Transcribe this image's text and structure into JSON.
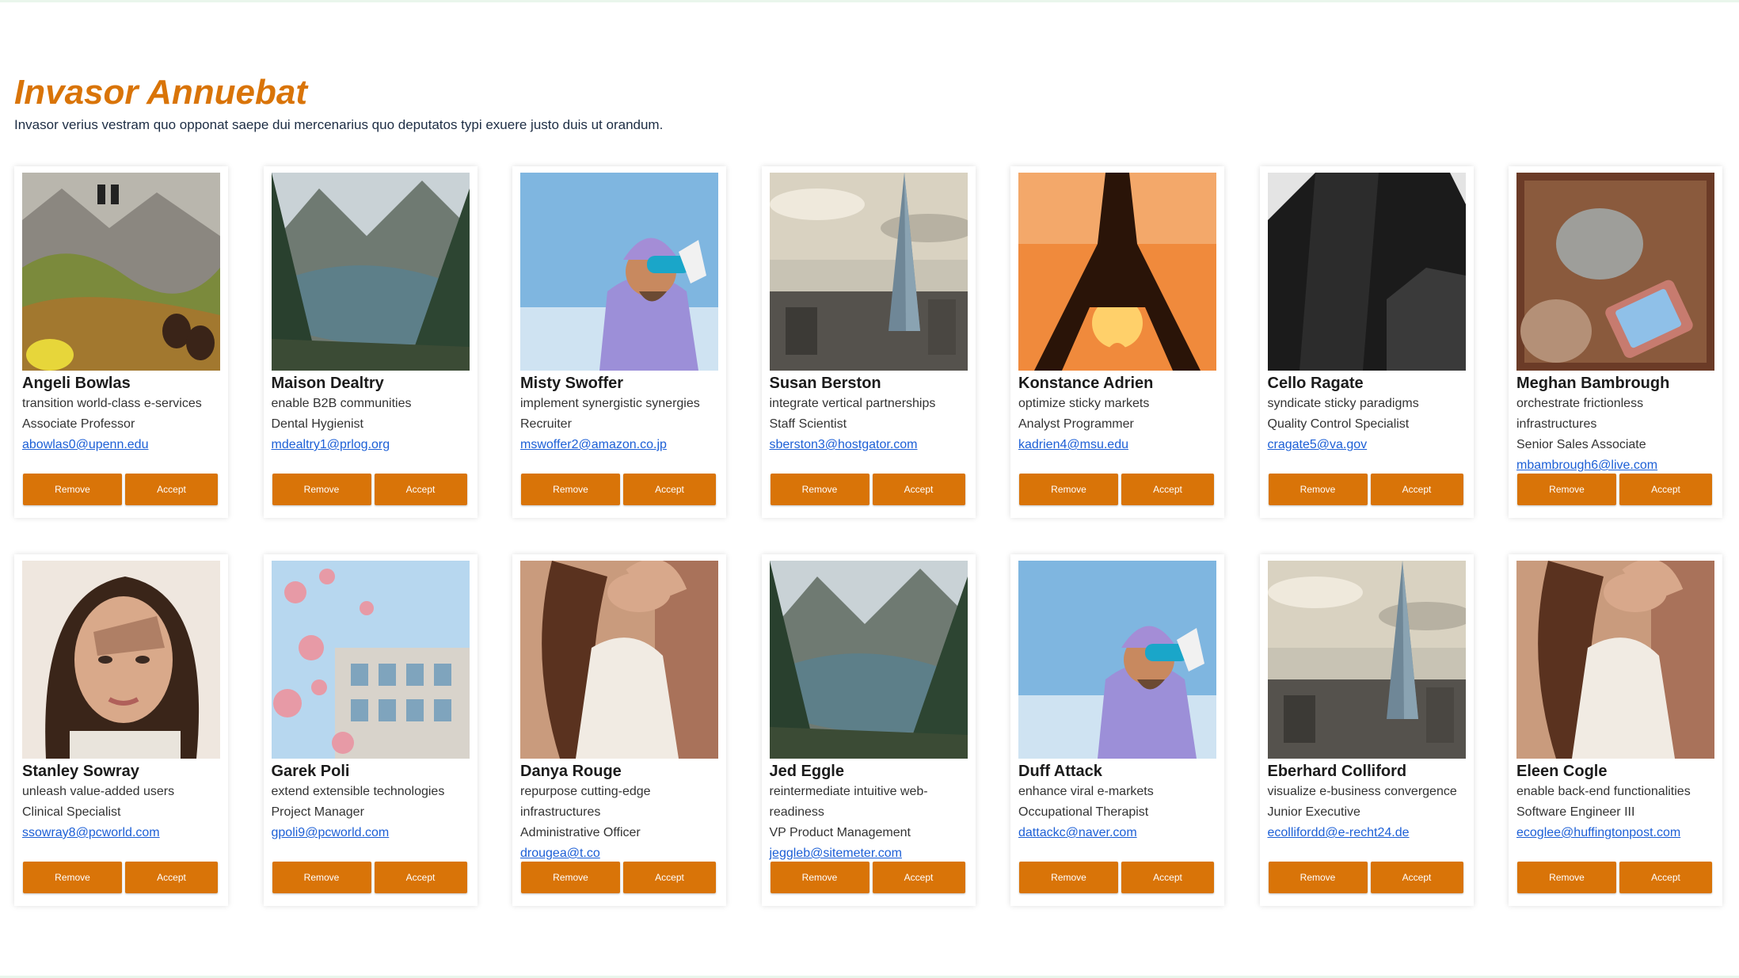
{
  "header": {
    "title": "Invasor Annuebat",
    "subtitle": "Invasor verius vestram quo opponat saepe dui mercenarius quo deputatos typi exuere justo duis ut orandum."
  },
  "buttons": {
    "remove": "Remove",
    "accept": "Accept"
  },
  "colors": {
    "accent": "#d97408",
    "link": "#1c5fd6",
    "title": "#d97408"
  },
  "cards": [
    {
      "name": "Angeli Bowlas",
      "tagline": "transition world-class e-services",
      "role": "Associate Professor",
      "email": "abowlas0@upenn.edu",
      "photo": "mountain-jump"
    },
    {
      "name": "Maison Dealtry",
      "tagline": "enable B2B communities",
      "role": "Dental Hygienist",
      "email": "mdealtry1@prlog.org",
      "photo": "lake-valley"
    },
    {
      "name": "Misty Swoffer",
      "tagline": "implement synergistic synergies",
      "role": "Recruiter",
      "email": "mswoffer2@amazon.co.jp",
      "photo": "skier"
    },
    {
      "name": "Susan Berston",
      "tagline": "integrate vertical partnerships",
      "role": "Staff Scientist",
      "email": "sberston3@hostgator.com",
      "photo": "skyscraper-city"
    },
    {
      "name": "Konstance Adrien",
      "tagline": "optimize sticky markets",
      "role": "Analyst Programmer",
      "email": "kadrien4@msu.edu",
      "photo": "eiffel-sunset"
    },
    {
      "name": "Cello Ragate",
      "tagline": "syndicate sticky paradigms",
      "role": "Quality Control Specialist",
      "email": "cragate5@va.gov",
      "photo": "dark-building"
    },
    {
      "name": "Meghan Bambrough",
      "tagline": "orchestrate frictionless infrastructures",
      "role": "Senior Sales Associate",
      "email": "mbambrough6@live.com",
      "photo": "suitcase-phone"
    },
    {
      "name": "Stanley Sowray",
      "tagline": "unleash value-added users",
      "role": "Clinical Specialist",
      "email": "ssowray8@pcworld.com",
      "photo": "portrait-woman"
    },
    {
      "name": "Garek Poli",
      "tagline": "extend extensible technologies",
      "role": "Project Manager",
      "email": "gpoli9@pcworld.com",
      "photo": "blossom-building"
    },
    {
      "name": "Danya Rouge",
      "tagline": "repurpose cutting-edge infrastructures",
      "role": "Administrative Officer",
      "email": "drougea@t.co",
      "photo": "woman-dress"
    },
    {
      "name": "Jed Eggle",
      "tagline": "reintermediate intuitive web-readiness",
      "role": "VP Product Management",
      "email": "jeggleb@sitemeter.com",
      "photo": "lake-valley"
    },
    {
      "name": "Duff Attack",
      "tagline": "enhance viral e-markets",
      "role": "Occupational Therapist",
      "email": "dattackc@naver.com",
      "photo": "skier"
    },
    {
      "name": "Eberhard Colliford",
      "tagline": "visualize e-business convergence",
      "role": "Junior Executive",
      "email": "ecollifordd@e-recht24.de",
      "photo": "skyscraper-city"
    },
    {
      "name": "Eleen Cogle",
      "tagline": "enable back-end functionalities",
      "role": "Software Engineer III",
      "email": "ecoglee@huffingtonpost.com",
      "photo": "woman-dress"
    }
  ]
}
